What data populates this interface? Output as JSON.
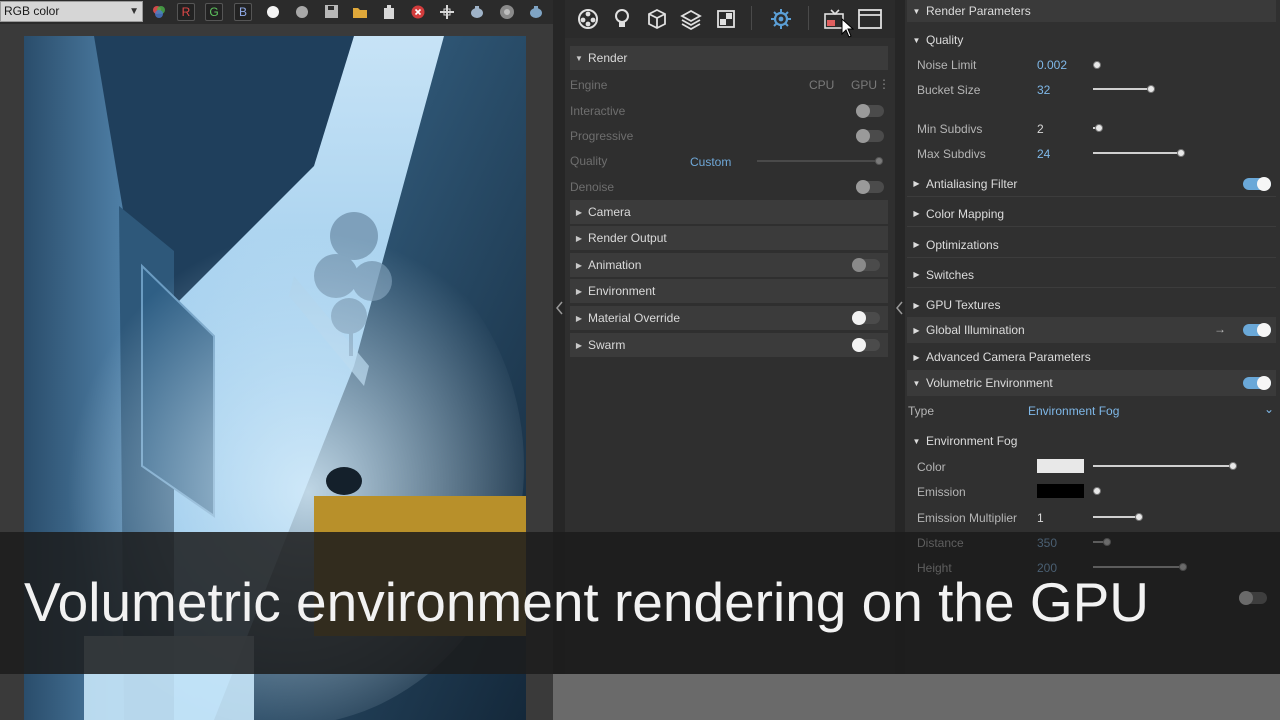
{
  "vfb": {
    "channel": "RGB color",
    "buttons": {
      "r": "R",
      "g": "G",
      "b": "B"
    }
  },
  "middle": {
    "render_header": "Render",
    "engine_label": "Engine",
    "engine_cpu": "CPU",
    "engine_gpu": "GPU",
    "interactive_label": "Interactive",
    "progressive_label": "Progressive",
    "quality_label": "Quality",
    "quality_value": "Custom",
    "denoise_label": "Denoise",
    "sections": [
      {
        "label": "Camera"
      },
      {
        "label": "Render Output"
      },
      {
        "label": "Animation"
      },
      {
        "label": "Environment"
      },
      {
        "label": "Material Override"
      },
      {
        "label": "Swarm"
      }
    ]
  },
  "right": {
    "render_params": "Render Parameters",
    "quality": "Quality",
    "noise_limit_label": "Noise Limit",
    "noise_limit": "0.002",
    "bucket_size_label": "Bucket Size",
    "bucket_size": "32",
    "min_subdivs_label": "Min Subdivs",
    "min_subdivs": "2",
    "max_subdivs_label": "Max Subdivs",
    "max_subdivs": "24",
    "antialiasing": "Antialiasing Filter",
    "color_mapping": "Color Mapping",
    "optimizations": "Optimizations",
    "switches": "Switches",
    "gpu_textures": "GPU Textures",
    "global_illumination": "Global Illumination",
    "advanced_camera": "Advanced Camera Parameters",
    "volumetric_env": "Volumetric Environment",
    "type_label": "Type",
    "type_value": "Environment Fog",
    "env_fog": "Environment Fog",
    "color_label": "Color",
    "emission_label": "Emission",
    "emission_mult_label": "Emission Multiplier",
    "emission_mult": "1",
    "distance_label": "Distance",
    "distance": "350",
    "height_label": "Height",
    "height": "200"
  },
  "colors": {
    "accent": "#6aa8d8",
    "value_blue": "#7fb8e8",
    "fog_color": "#e8e8e8",
    "emission_color": "#000000"
  },
  "banner": {
    "text": "Volumetric environment rendering on the GPU"
  }
}
